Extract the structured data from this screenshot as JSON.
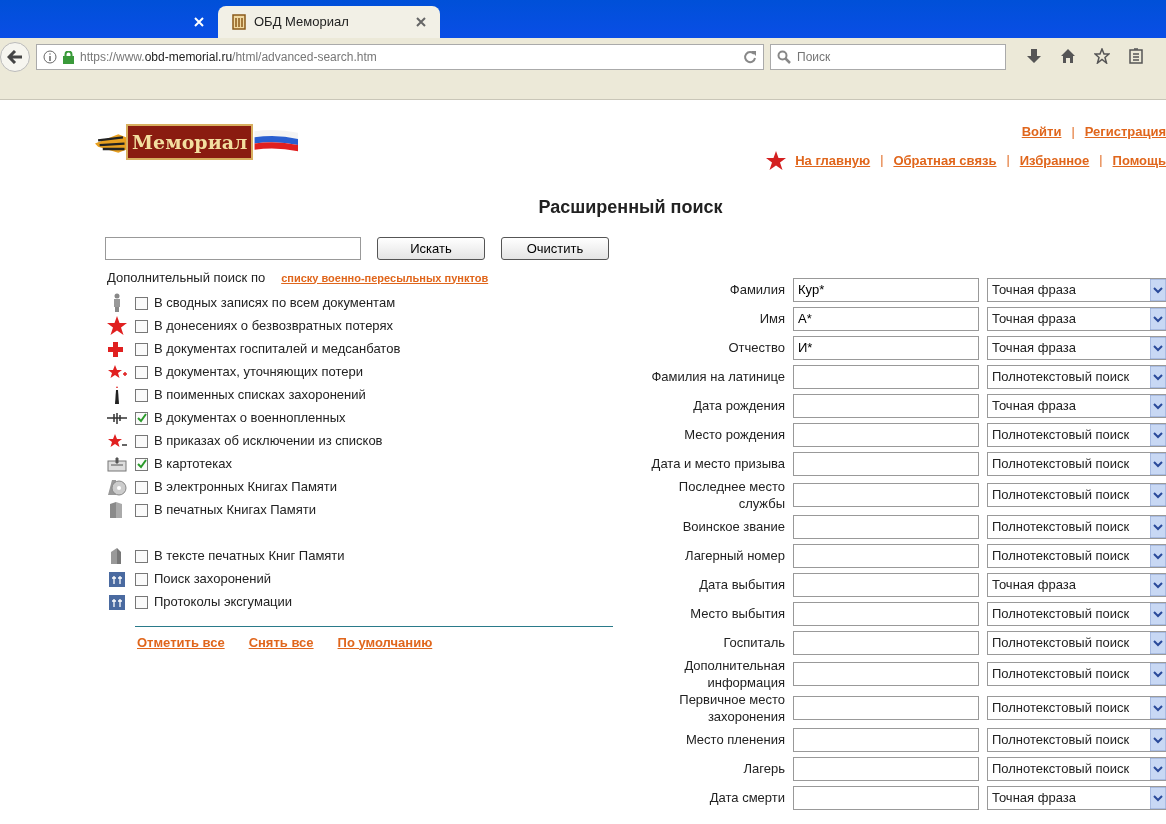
{
  "browser": {
    "tabs": [
      {
        "selected": false
      },
      {
        "title": "ОБД Мемориал",
        "selected": true
      }
    ],
    "url": {
      "scheme": "https://www.",
      "domain": "obd-memorial.ru",
      "path": "/html/advanced-search.htm"
    },
    "search_placeholder": "Поиск"
  },
  "header": {
    "logo_text": "Мемориал",
    "account_links": [
      "Войти",
      "Регистрация"
    ],
    "account_separators": [
      "|"
    ],
    "nav_separators": [
      "|",
      "|",
      "|"
    ],
    "nav_links": [
      "На главную",
      "Обратная связь",
      "Избранное",
      "Помощь"
    ]
  },
  "title": "Расширенный поиск",
  "quick_search": {
    "buttons": [
      "Искать",
      "Очистить"
    ]
  },
  "sources": {
    "intro": "Дополнительный поиск по",
    "intro_link": "списку военно-пересыльных пунктов",
    "groups": [
      [
        {
          "label": "В сводных записях по всем документам",
          "checked": false
        },
        {
          "label": "В донесениях о безвозвратных потерях",
          "checked": false
        },
        {
          "label": "В документах госпиталей и медсанбатов",
          "checked": false
        },
        {
          "label": "В документах, уточняющих потери",
          "checked": false
        },
        {
          "label": "В поименных списках захоронений",
          "checked": false
        },
        {
          "label": "В документах о военнопленных",
          "checked": true
        },
        {
          "label": "В приказах об исключении из списков",
          "checked": false
        },
        {
          "label": "В картотеках",
          "checked": true
        },
        {
          "label": "В электронных Книгах Памяти",
          "checked": false
        },
        {
          "label": "В печатных Книгах Памяти",
          "checked": false
        }
      ],
      [
        {
          "label": "В тексте печатных Книг Памяти",
          "checked": false
        },
        {
          "label": "Поиск захоронений",
          "checked": false
        },
        {
          "label": "Протоколы эксгумации",
          "checked": false
        }
      ]
    ],
    "actions": [
      "Отметить все",
      "Снять все",
      "По умолчанию"
    ]
  },
  "fields": [
    {
      "label": "Фамилия",
      "value": "Кур*",
      "mode": "Точная фраза"
    },
    {
      "label": "Имя",
      "value": "А*",
      "mode": "Точная фраза"
    },
    {
      "label": "Отчество",
      "value": "И*",
      "mode": "Точная фраза"
    },
    {
      "label": "Фамилия на латинице",
      "mode": "Полнотекстовый поиск"
    },
    {
      "label": "Дата рождения",
      "mode": "Точная фраза"
    },
    {
      "label": "Место рождения",
      "mode": "Полнотекстовый поиск"
    },
    {
      "label": "Дата и место призыва",
      "mode": "Полнотекстовый поиск"
    },
    {
      "label": "Последнее место службы",
      "mode": "Полнотекстовый поиск"
    },
    {
      "label": "Воинское звание",
      "mode": "Полнотекстовый поиск"
    },
    {
      "label": "Лагерный номер",
      "mode": "Полнотекстовый поиск"
    },
    {
      "label": "Дата выбытия",
      "mode": "Точная фраза"
    },
    {
      "label": "Место выбытия",
      "mode": "Полнотекстовый поиск"
    },
    {
      "label": "Госпиталь",
      "mode": "Полнотекстовый поиск"
    },
    {
      "label": "Дополнительная информация",
      "mode": "Полнотекстовый поиск"
    },
    {
      "label": "Первичное место захоронения",
      "mode": "Полнотекстовый поиск"
    },
    {
      "label": "Место пленения",
      "mode": "Полнотекстовый поиск"
    },
    {
      "label": "Лагерь",
      "mode": "Полнотекстовый поиск"
    },
    {
      "label": "Дата смерти",
      "mode": "Точная фраза"
    }
  ]
}
